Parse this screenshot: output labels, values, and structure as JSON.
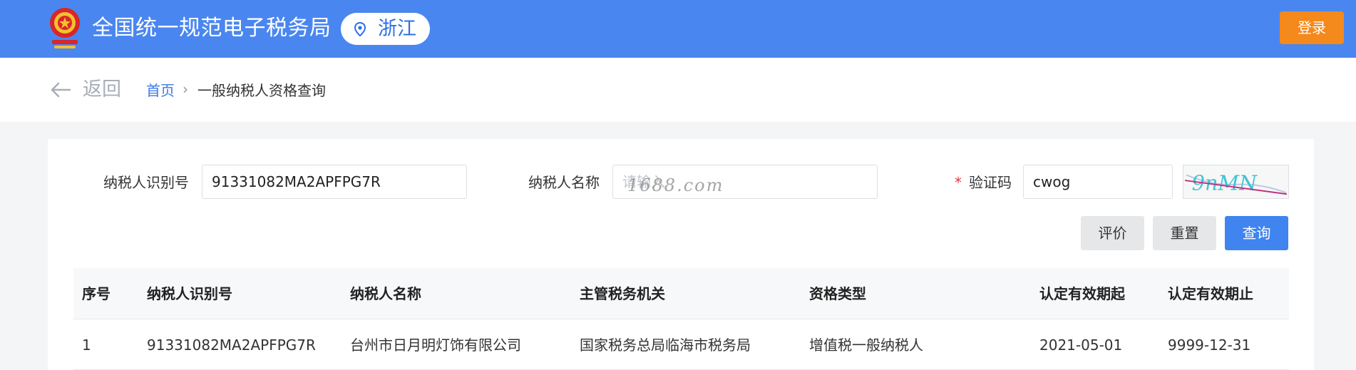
{
  "header": {
    "site_title": "全国统一规范电子税务局",
    "region": "浙江",
    "login_label": "登录",
    "colors": {
      "bar": "#4a86f0",
      "login": "#f4891c"
    }
  },
  "breadcrumb": {
    "back_label": "返回",
    "home": "首页",
    "separator": "›",
    "current": "一般纳税人资格查询"
  },
  "form": {
    "taxpayer_id_label": "纳税人识别号",
    "taxpayer_id_value": "91331082MA2APFPG7R",
    "taxpayer_name_label": "纳税人名称",
    "taxpayer_name_placeholder": "请输入",
    "watermark": "1688.com",
    "required_mark": "*",
    "captcha_label": "验证码",
    "captcha_value": "cwog",
    "captcha_text": "9nMN"
  },
  "actions": {
    "evaluate": "评价",
    "reset": "重置",
    "query": "查询"
  },
  "table": {
    "columns": [
      "序号",
      "纳税人识别号",
      "纳税人名称",
      "主管税务机关",
      "资格类型",
      "认定有效期起",
      "认定有效期止"
    ],
    "rows": [
      [
        "1",
        "91331082MA2APFPG7R",
        "台州市日月明灯饰有限公司",
        "国家税务总局临海市税务局",
        "增值税一般纳税人",
        "2021-05-01",
        "9999-12-31"
      ]
    ]
  }
}
